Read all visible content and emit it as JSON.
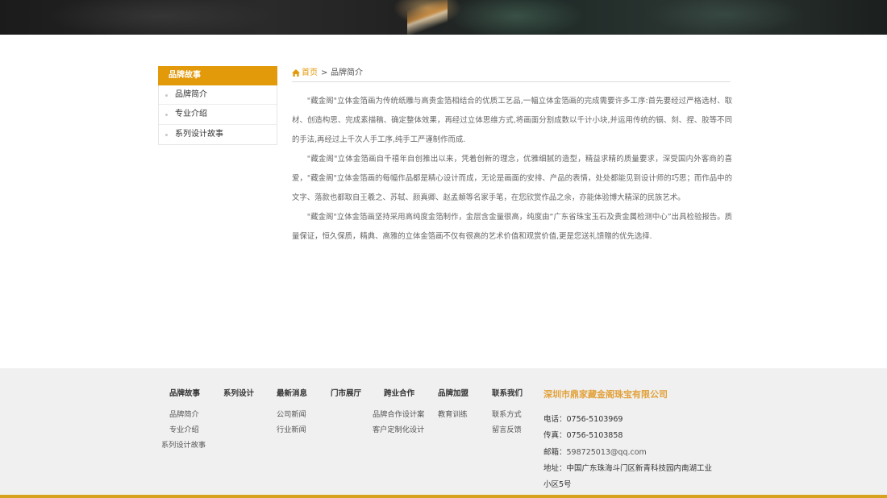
{
  "sidebar": {
    "title": "品牌故事",
    "items": [
      {
        "label": "品牌简介"
      },
      {
        "label": "专业介绍"
      },
      {
        "label": "系列设计故事"
      }
    ]
  },
  "breadcrumb": {
    "home": "首页",
    "separator": ">",
    "current": "品牌简介"
  },
  "content": {
    "paragraphs": [
      "\"藏金阁\"立体金箔画为传统纸雕与高贵金箔相结合的优质工艺品,一幅立体金箔画的完成需要许多工序:首先要经过严格选材、取材、创造构思、完成素描稿、确定整体效果，再经过立体思维方式,将画面分割成数以千计小块,并运用传统的镉、刻、捏、胶等不同的手法,再经过上千次人手工序,纯手工严谨制作而成.",
      "\"藏金阁\"立体金箔画自千禧年自创推出以来，凭着创新的理念，优雅细腻的造型，精益求精的质量要求，深受国内外客商的喜爱，\"藏金阁\"立体金箔画的每幅作品都是精心设计而成，无论是画面的安排、产品的表情，处处都能见到设计师的巧思；而作品中的文字、落款也都取自王羲之、苏轼、颜真卿、赵孟頫等名家手笔，在您欣赏作品之余，亦能体验博大精深的民族艺术。",
      "\"藏金阁\"立体金箔画坚持采用高纯度金箔制作，金层含金量很高，纯度由“广东省珠宝玉石及贵金属检测中心”出具检验报告。质量保证，恒久保质，精典、高雅的立体金箔画不仅有很高的艺术价值和观赏价值,更是您送礼馈赠的优先选择."
    ]
  },
  "footer": {
    "columns": [
      {
        "title": "品牌故事",
        "links": [
          "品牌简介",
          "专业介绍",
          "系列设计故事"
        ]
      },
      {
        "title": "系列设计",
        "links": []
      },
      {
        "title": "最新消息",
        "links": [
          "公司新闻",
          "行业新闻"
        ]
      },
      {
        "title": "门市展厅",
        "links": []
      },
      {
        "title": "跨业合作",
        "links": [
          "品牌合作设计案",
          "客户定制化设计"
        ]
      },
      {
        "title": "品牌加盟",
        "links": [
          "教育训练"
        ]
      },
      {
        "title": "联系我们",
        "links": [
          "联系方式",
          "留言反馈"
        ]
      }
    ],
    "company": {
      "name": "深圳市鼎家藏金阁珠宝有限公司",
      "phone": "电话：0756-5103969",
      "fax": "传真：0756-5103858",
      "email_label": "邮箱：",
      "email": "598725013@qq.com",
      "address_line1": "地址：中国广东珠海斗门区新青科技园内南湖工业",
      "address_line2": "小区5号"
    }
  },
  "colors": {
    "accent": "#e2990a",
    "company_name": "#e2a13a",
    "footer_bg": "#f0f0f0",
    "footer_bar": "#d7a21f"
  }
}
